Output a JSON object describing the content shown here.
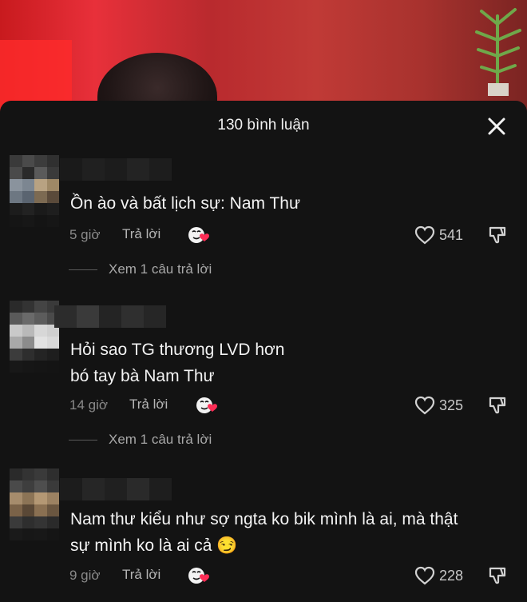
{
  "header": {
    "title": "130 bình luận",
    "close_icon": "close-icon"
  },
  "comments": [
    {
      "text_lines": [
        "Ồn ào và bất lịch sự: Nam Thư"
      ],
      "time": "5 giờ",
      "reply_label": "Trả lời",
      "likes": "541",
      "view_replies": "Xem 1 câu trả lời"
    },
    {
      "text_lines": [
        "Hỏi sao TG thương LVD hơn",
        "bó tay bà Nam Thư"
      ],
      "time": "14 giờ",
      "reply_label": "Trả lời",
      "likes": "325",
      "view_replies": "Xem 1 câu trả lời"
    },
    {
      "text_lines": [
        "Nam thư kiểu như sợ ngta ko bik mình là ai, mà thật",
        "sự mình ko là ai cả 😏"
      ],
      "time": "9 giờ",
      "reply_label": "Trả lời",
      "likes": "228"
    }
  ],
  "colors": {
    "sheet_bg": "#131313",
    "text": "#f3f3f3",
    "muted": "#8a8a8a",
    "reaction_red": "#fe2c55"
  },
  "icons": {
    "reaction": "emoji-reaction-icon",
    "like": "heart-icon",
    "dislike": "dislike-icon"
  }
}
